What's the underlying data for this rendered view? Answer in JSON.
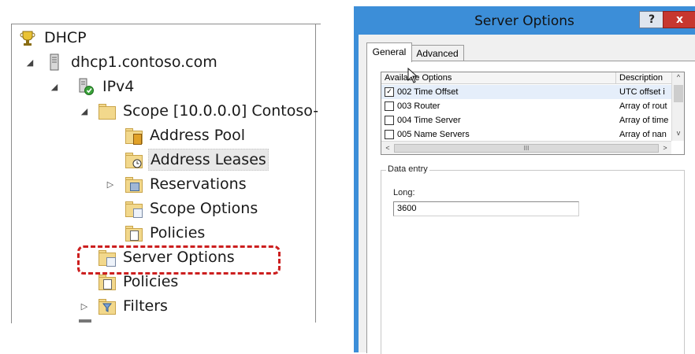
{
  "tree": {
    "root": "DHCP",
    "server": "dhcp1.contoso.com",
    "ipv4": "IPv4",
    "scope": "Scope [10.0.0.0] Contoso-",
    "address_pool": "Address Pool",
    "address_leases": "Address Leases",
    "reservations": "Reservations",
    "scope_options": "Scope Options",
    "scope_policies": "Policies",
    "server_options": "Server Options",
    "policies": "Policies",
    "filters": "Filters",
    "expanded_glyph": "◢",
    "collapsed_glyph": "▷"
  },
  "dialog": {
    "title": "Server Options",
    "help": "?",
    "close": "x",
    "tabs": {
      "general": "General",
      "advanced": "Advanced"
    },
    "list": {
      "col_options": "Available Options",
      "col_description": "Description",
      "rows": [
        {
          "name": "002 Time Offset",
          "desc": "UTC offset i",
          "checked": true
        },
        {
          "name": "003 Router",
          "desc": "Array of rout",
          "checked": false
        },
        {
          "name": "004 Time Server",
          "desc": "Array of time",
          "checked": false
        },
        {
          "name": "005 Name Servers",
          "desc": "Array of nan",
          "checked": false
        }
      ],
      "check_mark": "✓",
      "scroll_up": "^",
      "scroll_down": "v",
      "scroll_left": "<",
      "scroll_right": ">",
      "thumb_grip": "III"
    },
    "data_entry": {
      "legend": "Data entry",
      "long_label": "Long:",
      "long_value": "3600"
    }
  },
  "colors": {
    "title_bar": "#3c8ed8",
    "close_button": "#c7372f",
    "highlight_dash": "#cc1f1f"
  }
}
